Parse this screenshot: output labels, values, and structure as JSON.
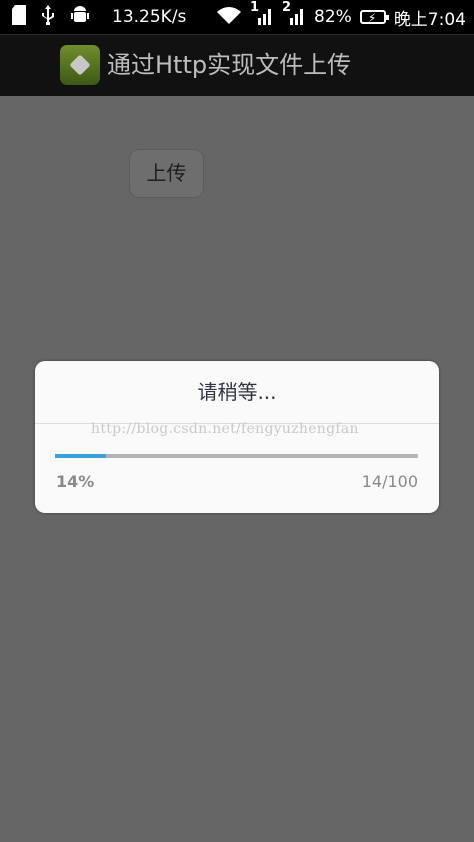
{
  "status_bar": {
    "speed": "13.25K/s",
    "sim1": "1",
    "sim2": "2",
    "battery": "82%",
    "time": "晚上7:04",
    "icons": [
      "sd-card-icon",
      "usb-icon",
      "android-debug-icon",
      "wifi-icon",
      "signal-icon",
      "battery-icon"
    ]
  },
  "app": {
    "title": "通过Http实现文件上传"
  },
  "content": {
    "upload_label": "上传"
  },
  "dialog": {
    "title": "请稍等...",
    "watermark": "http://blog.csdn.net/fengyuzhengfan",
    "progress": 14,
    "max": 100,
    "percent_text": "14%",
    "count_text": "14/100"
  },
  "colors": {
    "accent": "#3aa1dc",
    "overlay": "#666666"
  }
}
